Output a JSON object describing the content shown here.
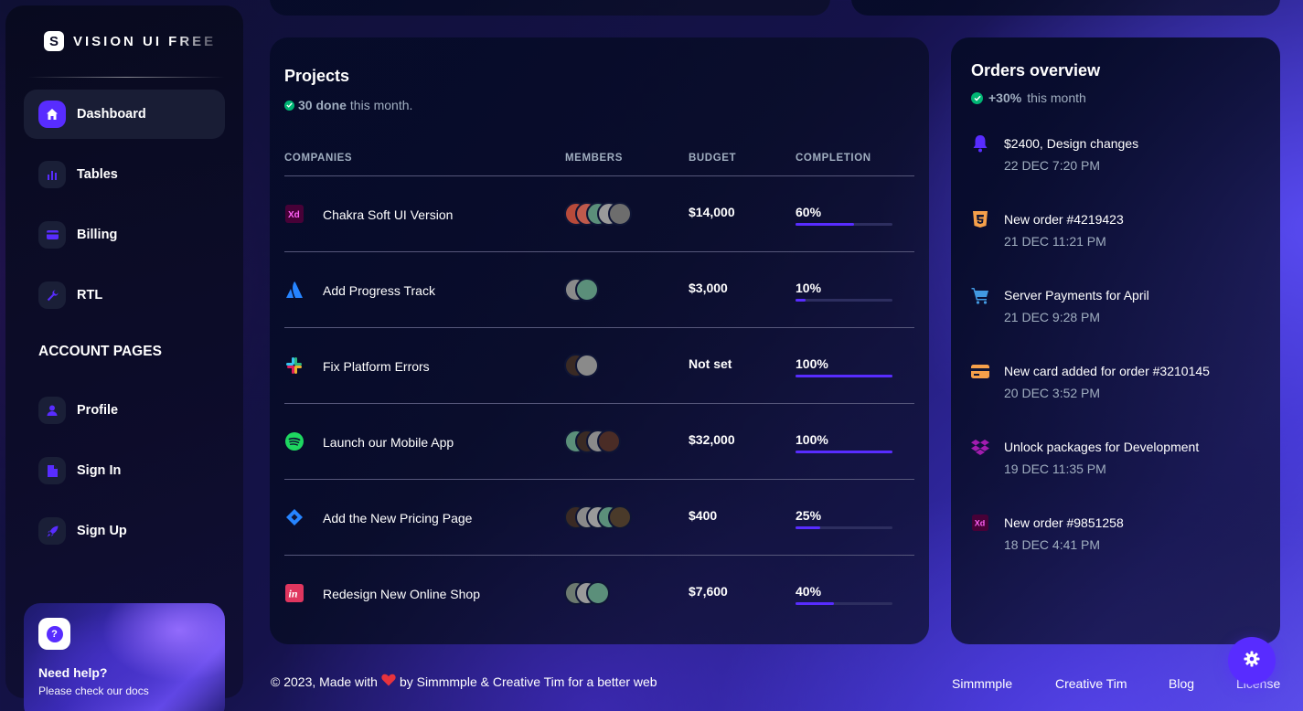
{
  "brand": {
    "logo_letter": "S",
    "name": "VISION UI FREE"
  },
  "sidebar": {
    "items": [
      {
        "label": "Dashboard",
        "icon": "home-icon",
        "active": true
      },
      {
        "label": "Tables",
        "icon": "bar-chart-icon"
      },
      {
        "label": "Billing",
        "icon": "credit-card-icon"
      },
      {
        "label": "RTL",
        "icon": "wrench-icon"
      }
    ],
    "section_title": "ACCOUNT PAGES",
    "account_items": [
      {
        "label": "Profile",
        "icon": "person-icon"
      },
      {
        "label": "Sign In",
        "icon": "document-icon"
      },
      {
        "label": "Sign Up",
        "icon": "rocket-icon"
      }
    ],
    "help": {
      "title": "Need help?",
      "subtitle": "Please check our docs",
      "icon": "question-icon"
    }
  },
  "projects": {
    "title": "Projects",
    "done_count": "30 done",
    "done_suffix": "this month.",
    "columns": [
      "COMPANIES",
      "MEMBERS",
      "BUDGET",
      "COMPLETION"
    ],
    "rows": [
      {
        "logo": "adobe-xd-icon",
        "company": "Chakra Soft UI Version",
        "members": 5,
        "budget": "$14,000",
        "completion": "60%",
        "progress": 0.6
      },
      {
        "logo": "atlassian-icon",
        "company": "Add Progress Track",
        "members": 2,
        "budget": "$3,000",
        "completion": "10%",
        "progress": 0.1
      },
      {
        "logo": "slack-icon",
        "company": "Fix Platform Errors",
        "members": 2,
        "budget": "Not set",
        "completion": "100%",
        "progress": 1.0
      },
      {
        "logo": "spotify-icon",
        "company": "Launch our Mobile App",
        "members": 4,
        "budget": "$32,000",
        "completion": "100%",
        "progress": 1.0
      },
      {
        "logo": "jira-icon",
        "company": "Add the New Pricing Page",
        "members": 5,
        "budget": "$400",
        "completion": "25%",
        "progress": 0.25
      },
      {
        "logo": "invision-icon",
        "company": "Redesign New Online Shop",
        "members": 3,
        "budget": "$7,600",
        "completion": "40%",
        "progress": 0.4
      }
    ]
  },
  "orders": {
    "title": "Orders overview",
    "growth": "+30%",
    "growth_suffix": "this month",
    "items": [
      {
        "icon": "bell-icon",
        "title": "$2400, Design changes",
        "date": "22 DEC 7:20 PM",
        "color": "#582cff"
      },
      {
        "icon": "html5-icon",
        "title": "New order #4219423",
        "date": "21 DEC 11:21 PM",
        "color": "#f6a04a"
      },
      {
        "icon": "cart-icon",
        "title": "Server Payments for April",
        "date": "21 DEC 9:28 PM",
        "color": "#4299e1"
      },
      {
        "icon": "credit-card-icon",
        "title": "New card added for order #3210145",
        "date": "20 DEC 3:52 PM",
        "color": "#f6a04a"
      },
      {
        "icon": "dropbox-icon",
        "title": "Unlock packages for Development",
        "date": "19 DEC 11:35 PM",
        "color": "#a21caf"
      },
      {
        "icon": "adobe-xd-icon",
        "title": "New order #9851258",
        "date": "18 DEC 4:41 PM",
        "color": "#ff2bbf"
      }
    ]
  },
  "footer": {
    "copyright_prefix": "© 2023, Made with",
    "copyright_suffix": "by Simmmple & Creative Tim for a better web",
    "links": [
      "Simmmple",
      "Creative Tim",
      "Blog",
      "License"
    ]
  },
  "colors": {
    "accent": "#582cff",
    "success": "#01b574",
    "muted": "#a0aec0"
  }
}
